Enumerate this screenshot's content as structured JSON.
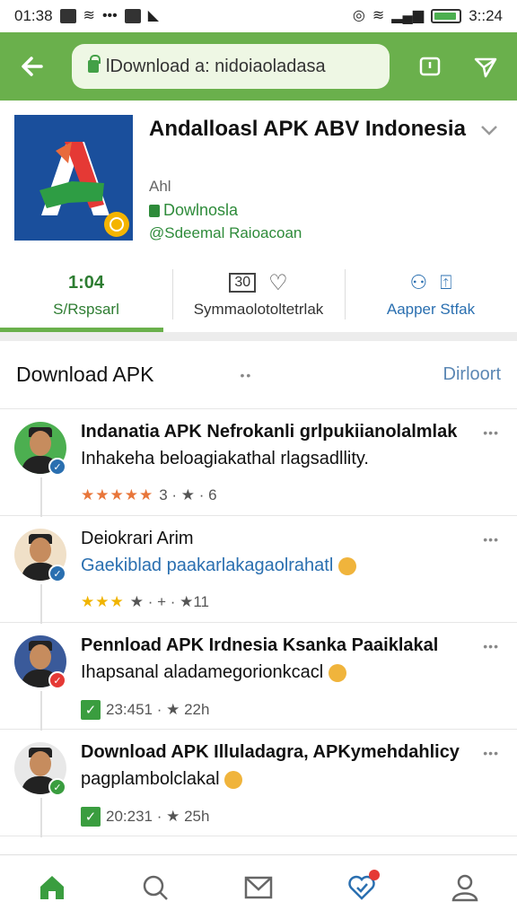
{
  "status_bar": {
    "time_left": "01:38",
    "time_right": "3::24"
  },
  "app_bar": {
    "url": "lDownload a: nidoiaoladasa"
  },
  "app": {
    "title": "Andalloasl APK ABV Indonesia",
    "subtitle": "Ahl",
    "developer": "Dowlnosla",
    "handle": "@Sdeemal Raioacoan"
  },
  "stats": [
    {
      "value": "1:04",
      "label": "S/Rspsarl",
      "color": "green"
    },
    {
      "value": "30",
      "label": "Symmaolotoltetrlak",
      "color": "gray"
    },
    {
      "value": "",
      "label": "Aapper Stfak",
      "color": "blue"
    }
  ],
  "section": {
    "title": "Download APK",
    "link": "Dirloort"
  },
  "comments": [
    {
      "line1": "Indanatia APK Nefrokanli grlpukiianolalmlak",
      "line2": "Inhakeha beloagiakathal rlagsadllity.",
      "meta_stars": "★★★★★",
      "meta_text": "3 · ★ · 6",
      "badge_color": "#2a6fb0",
      "avatar_bg": "#4caf50",
      "has_check": false,
      "blue_line2": false,
      "bold_name": true
    },
    {
      "line1": "Deiokrari Arim",
      "line2": "Gaekiblad paakarlakagaolrahatl",
      "meta_stars": "★★★",
      "meta_text": "★ · + · ★11",
      "badge_color": "#2a6fb0",
      "avatar_bg": "#f0e0c8",
      "has_check": false,
      "blue_line2": true,
      "bold_name": false
    },
    {
      "line1": "Pennload APK Irdnesia Ksanka Paaiklakal",
      "line2": "Ihapsanal aladamegorionkcacl",
      "meta_stars": "",
      "meta_text": "23:451 · ★ 22h",
      "badge_color": "#e53935",
      "avatar_bg": "#3a5a9a",
      "has_check": true,
      "blue_line2": false,
      "bold_name": true
    },
    {
      "line1": "Download APK Illuladagra, APKymehdahlicy",
      "line2": "pagplambolclakal",
      "meta_stars": "",
      "meta_text": "20:231 · ★ 25h",
      "badge_color": "#3a9d3f",
      "avatar_bg": "#e8e8e8",
      "has_check": true,
      "blue_line2": false,
      "bold_name": true
    }
  ],
  "bottom_nav": {
    "items": [
      "home-icon",
      "search-icon",
      "mail-icon",
      "heart-check-icon",
      "profile-icon"
    ],
    "active_color": "#3a9d3f"
  }
}
